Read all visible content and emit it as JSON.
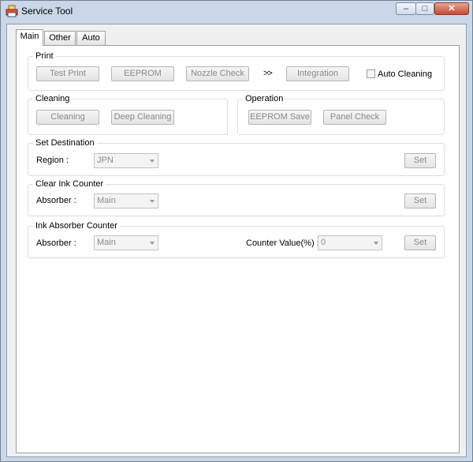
{
  "window": {
    "title": "Service Tool",
    "controls": {
      "minimize": "–",
      "maximize": "□",
      "close": "✕"
    }
  },
  "tabs": [
    {
      "label": "Main"
    },
    {
      "label": "Other"
    },
    {
      "label": "Auto"
    }
  ],
  "print": {
    "legend": "Print",
    "test_print": "Test Print",
    "eeprom": "EEPROM",
    "nozzle_check": "Nozzle Check",
    "arrow": ">>",
    "integration": "Integration",
    "auto_cleaning": "Auto Cleaning"
  },
  "cleaning": {
    "legend": "Cleaning",
    "cleaning": "Cleaning",
    "deep_cleaning": "Deep Cleaning"
  },
  "operation": {
    "legend": "Operation",
    "eeprom_save": "EEPROM Save",
    "panel_check": "Panel Check"
  },
  "set_destination": {
    "legend": "Set Destination",
    "region_label": "Region :",
    "region_value": "JPN",
    "set": "Set"
  },
  "clear_ink_counter": {
    "legend": "Clear Ink Counter",
    "absorber_label": "Absorber :",
    "absorber_value": "Main",
    "set": "Set"
  },
  "ink_absorber_counter": {
    "legend": "Ink Absorber Counter",
    "absorber_label": "Absorber :",
    "absorber_value": "Main",
    "counter_label": "Counter Value(%) :",
    "counter_value": "0",
    "set": "Set"
  }
}
